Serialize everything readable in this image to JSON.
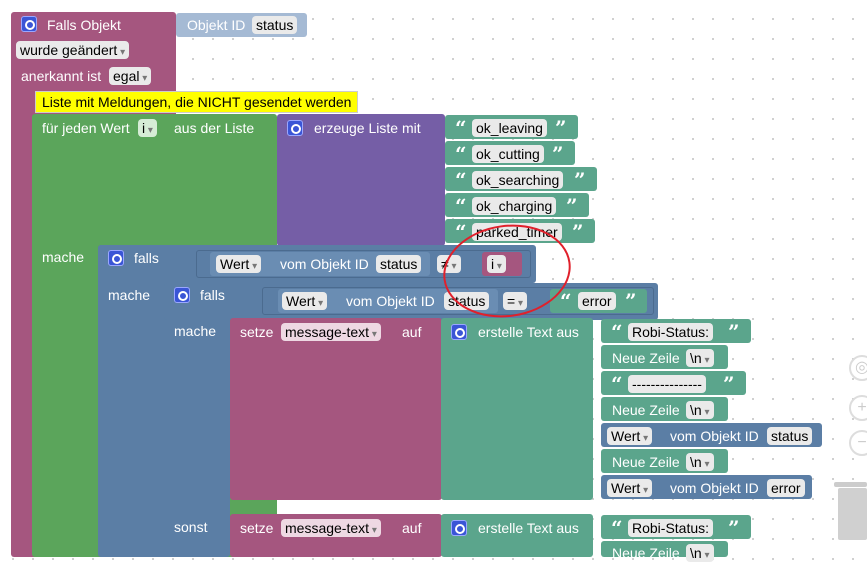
{
  "trigger": {
    "title": "Falls Objekt",
    "objekt_id_label": "Objekt ID",
    "objekt_id_value": "status",
    "changed": "wurde geändert",
    "acknowledged_label": "anerkannt ist",
    "acknowledged_value": "egal"
  },
  "comment": "Liste mit Meldungen, die NICHT gesendet werden",
  "loop": {
    "label": "für jeden Wert",
    "var": "i",
    "from_list": "aus der Liste",
    "do_label": "mache",
    "create_list": "erzeuge Liste mit",
    "items": [
      "ok_leaving",
      "ok_cutting",
      "ok_searching",
      "ok_charging",
      "parked_timer"
    ]
  },
  "outer_if": {
    "label": "falls",
    "do_label": "mache",
    "wert": "Wert",
    "vom_objekt": "vom Objekt ID",
    "objekt": "status",
    "op": "≠",
    "var": "i"
  },
  "inner_if": {
    "label": "falls",
    "do_label": "mache",
    "else_label": "sonst",
    "wert": "Wert",
    "vom_objekt": "vom Objekt ID",
    "objekt": "status",
    "op": "=",
    "text": "error"
  },
  "set1": {
    "setze": "setze",
    "var": "message-text",
    "auf": "auf",
    "create_text": "erstelle Text aus",
    "robi": "Robi-Status:",
    "newline": "Neue Zeile",
    "nl": "\\n",
    "dashes": "---------------",
    "wert": "Wert",
    "vom_objekt": "vom Objekt ID",
    "obj1": "status",
    "obj2": "error"
  },
  "set2": {
    "setze": "setze",
    "var": "message-text",
    "auf": "auf",
    "create_text": "erstelle Text aus",
    "robi": "Robi-Status:",
    "newline": "Neue Zeile",
    "nl": "\\n"
  },
  "colors": {
    "event": "#a5567f",
    "loop": "#5ba55b",
    "list": "#755ea6",
    "logic": "#5b7ea5",
    "text": "#5ba58c",
    "highlight": "#e0202b"
  }
}
